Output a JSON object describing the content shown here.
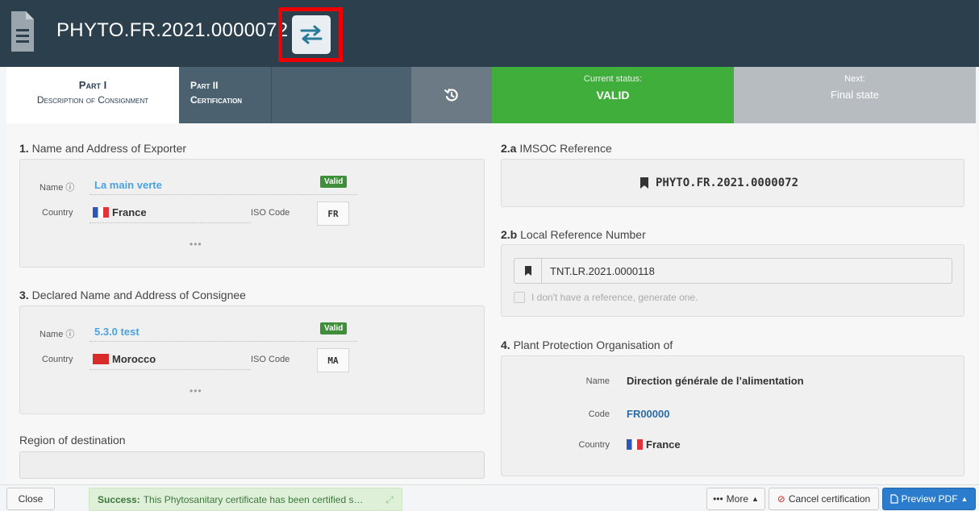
{
  "header": {
    "title": "PHYTO.FR.2021.0000072"
  },
  "tabs": {
    "part1_title": "Part I",
    "part1_sub": "Description of Consignment",
    "part2_title": "Part II",
    "part2_sub": "Certification",
    "current_status_label": "Current status:",
    "current_status_value": "VALID",
    "next_label": "Next:",
    "next_value": "Final state"
  },
  "exporter": {
    "num": "1.",
    "title": "Name and Address of Exporter",
    "name_label": "Name",
    "name_value": "La main verte",
    "badge": "Valid",
    "country_label": "Country",
    "country_value": "France",
    "iso_label": "ISO Code",
    "iso_value": "FR",
    "more": "•••"
  },
  "consignee": {
    "num": "3.",
    "title": "Declared Name and Address of Consignee",
    "name_label": "Name",
    "name_value": "5.3.0 test",
    "badge": "Valid",
    "country_label": "Country",
    "country_value": "Morocco",
    "iso_label": "ISO Code",
    "iso_value": "MA",
    "more": "•••"
  },
  "region": {
    "title": "Region of destination"
  },
  "imsoc": {
    "num": "2.a",
    "title": "IMSOC Reference",
    "value": "PHYTO.FR.2021.0000072"
  },
  "lrn": {
    "num": "2.b",
    "title": "Local Reference Number",
    "value": "TNT.LR.2021.0000118",
    "checkbox_label": "I don't have a reference, generate one."
  },
  "ppo": {
    "num": "4.",
    "title": "Plant Protection Organisation of",
    "name_label": "Name",
    "name_value": "Direction générale de l’alimentation",
    "code_label": "Code",
    "code_value": "FR00000",
    "country_label": "Country",
    "country_value": "France"
  },
  "bottom": {
    "close": "Close",
    "toast_bold": "Success:",
    "toast_text": "This Phytosanitary certificate has been certified s…",
    "more": "More",
    "cancel": "Cancel certification",
    "preview": "Preview PDF"
  },
  "colors": {
    "header_bg": "#2b3f4d",
    "status_green": "#3fae3b",
    "link_blue": "#4aa3df",
    "highlight_red": "#ee0000",
    "primary_blue": "#2b7ccc"
  }
}
